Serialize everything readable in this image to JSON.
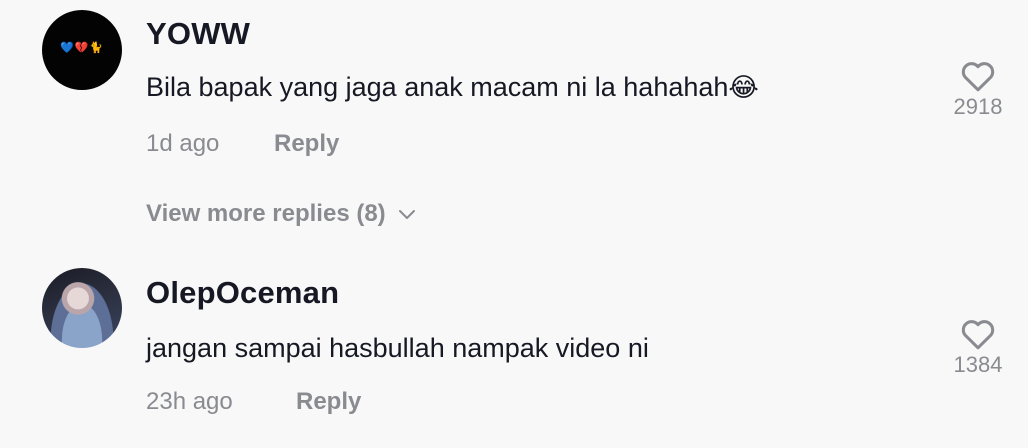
{
  "comments": [
    {
      "username": "YOWW",
      "avatar_icon": "heart-emoji-avatar",
      "avatar_glyphs": "💙💔🐈",
      "text": "Bila bapak yang jaga anak macam ni la hahahah",
      "emoji": "😂",
      "time": "1d ago",
      "reply_label": "Reply",
      "likes": "2918"
    },
    {
      "username": "OlepOceman",
      "avatar_icon": "profile-photo-avatar",
      "text": "jangan sampai hasbullah nampak video ni",
      "time": "23h ago",
      "reply_label": "Reply",
      "likes": "1384"
    }
  ],
  "view_more_replies": "View more replies (8)",
  "colors": {
    "primary_text": "#161823",
    "secondary_text": "#8a8b91",
    "background": "#f8f8f8"
  }
}
